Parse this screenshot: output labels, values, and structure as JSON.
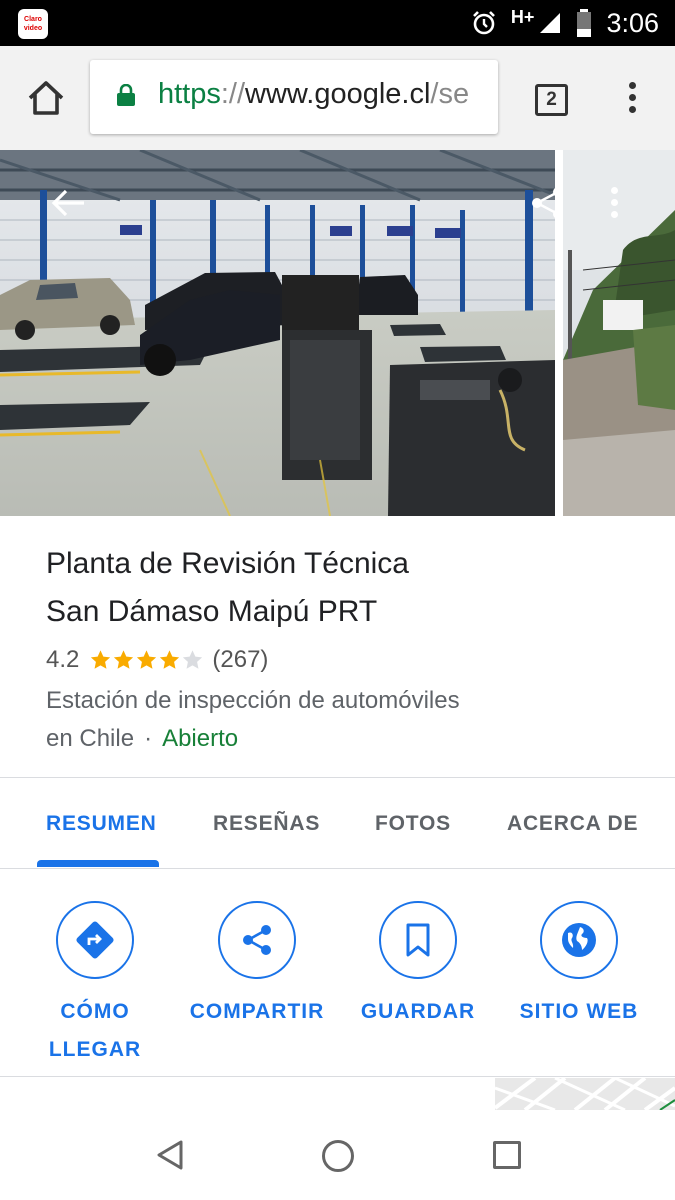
{
  "status_bar": {
    "app_badge": "Claro video",
    "network": "H+",
    "time": "3:06",
    "icons": [
      "alarm-icon",
      "signal-icon",
      "battery-icon"
    ]
  },
  "browser": {
    "url_scheme": "https",
    "url_sep": "://",
    "url_host": "www.google.cl",
    "url_rest": "/se",
    "tab_count": "2",
    "icons": [
      "home-icon",
      "lock-icon",
      "menu-icon"
    ]
  },
  "place": {
    "title_line1": "Planta de Revisión Técnica",
    "title_line2": "San Dámaso Maipú PRT",
    "rating": "4.2",
    "stars_filled": 4,
    "stars_total": 5,
    "review_count": "(267)",
    "category_line1": "Estación de inspección de automóviles",
    "category_line2": "en Chile",
    "separator": "·",
    "open_status": "Abierto"
  },
  "tabs": [
    {
      "label": "RESUMEN",
      "active": true
    },
    {
      "label": "RESEÑAS",
      "active": false
    },
    {
      "label": "FOTOS",
      "active": false
    },
    {
      "label": "ACERCA DE",
      "active": false
    }
  ],
  "actions": [
    {
      "label_line1": "CÓMO",
      "label_line2": "LLEGAR",
      "icon": "directions-icon"
    },
    {
      "label_line1": "COMPARTIR",
      "label_line2": "",
      "icon": "share-icon"
    },
    {
      "label_line1": "GUARDAR",
      "label_line2": "",
      "icon": "bookmark-icon"
    },
    {
      "label_line1": "SITIO WEB",
      "label_line2": "",
      "icon": "globe-icon"
    }
  ],
  "colors": {
    "accent": "#1a73e8",
    "star": "#f9ab00",
    "open_green": "#188038"
  }
}
